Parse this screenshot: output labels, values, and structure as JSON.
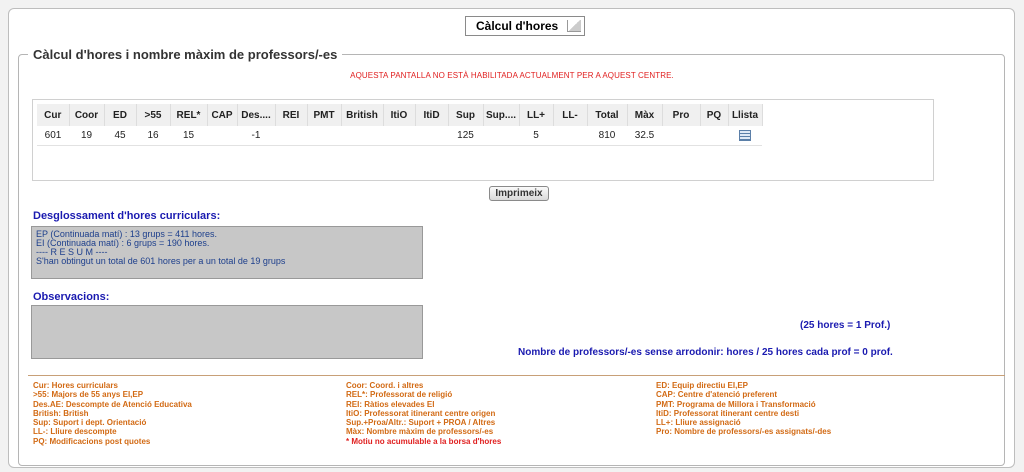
{
  "header": {
    "tab_title": "Càlcul d'hores"
  },
  "section": {
    "legend": "Càlcul d'hores i nombre màxim de professors/-es",
    "warning": "AQUESTA PANTALLA NO ESTÀ HABILITADA ACTUALMENT PER A AQUEST CENTRE."
  },
  "grid": {
    "columns": [
      "Cur",
      "Coor",
      "ED",
      ">55",
      "REL*",
      "CAP",
      "Des....",
      "REI",
      "PMT",
      "British",
      "ItiO",
      "ItiD",
      "Sup",
      "Sup....",
      "LL+",
      "LL-",
      "Total",
      "Màx",
      "Pro",
      "PQ",
      "Llista"
    ],
    "row": [
      "601",
      "19",
      "45",
      "16",
      "15",
      "",
      "-1",
      "",
      "",
      "",
      "",
      "",
      "125",
      "",
      "5",
      "",
      "810",
      "32.5",
      "",
      "",
      ""
    ]
  },
  "print_button": "Imprimeix",
  "desglossament": {
    "title": "Desglossament d'hores curriculars:",
    "lines": [
      "EP (Continuada matí) : 13 grups = 411 hores.",
      "EI (Continuada matí) : 6 grups = 190 hores.",
      "---- R E S U M ----",
      "S'han obtingut un total de 601 hores per a un total de 19 grups"
    ]
  },
  "observacions": {
    "title": "Observacions:"
  },
  "notes": {
    "ratio": "(25 hores = 1 Prof.)",
    "summary": "Nombre de professors/-es sense arrodonir: hores / 25 hores cada prof = 0 prof."
  },
  "legend": {
    "col1": [
      "Cur: Hores curriculars",
      ">55: Majors de 55 anys EI,EP",
      "Des.AE: Descompte de Atenció Educativa",
      "British: British",
      "Sup: Suport i dept. Orientació",
      "LL-: Lliure descompte",
      "PQ: Modificacions post quotes"
    ],
    "col2": [
      "Coor: Coord. i altres",
      "REL*: Professorat de religió",
      "REI: Ràtios elevades EI",
      "ItiO: Professorat itinerant centre origen",
      "Sup.+Proa/Altr.: Suport + PROA / Altres",
      "Màx: Nombre màxim de professors/-es"
    ],
    "col2_note": "* Motiu no acumulable a la borsa d'hores",
    "col3": [
      "ED: Equip directiu EI,EP",
      "CAP: Centre d'atenció preferent",
      "PMT: Programa de Millora i Transformació",
      "ItiD: Professorat itinerant centre desti",
      "LL+: Lliure assignació",
      "Pro: Nombre de professors/-es assignats/-des"
    ]
  },
  "icons": {
    "llista": "document-list-icon"
  }
}
